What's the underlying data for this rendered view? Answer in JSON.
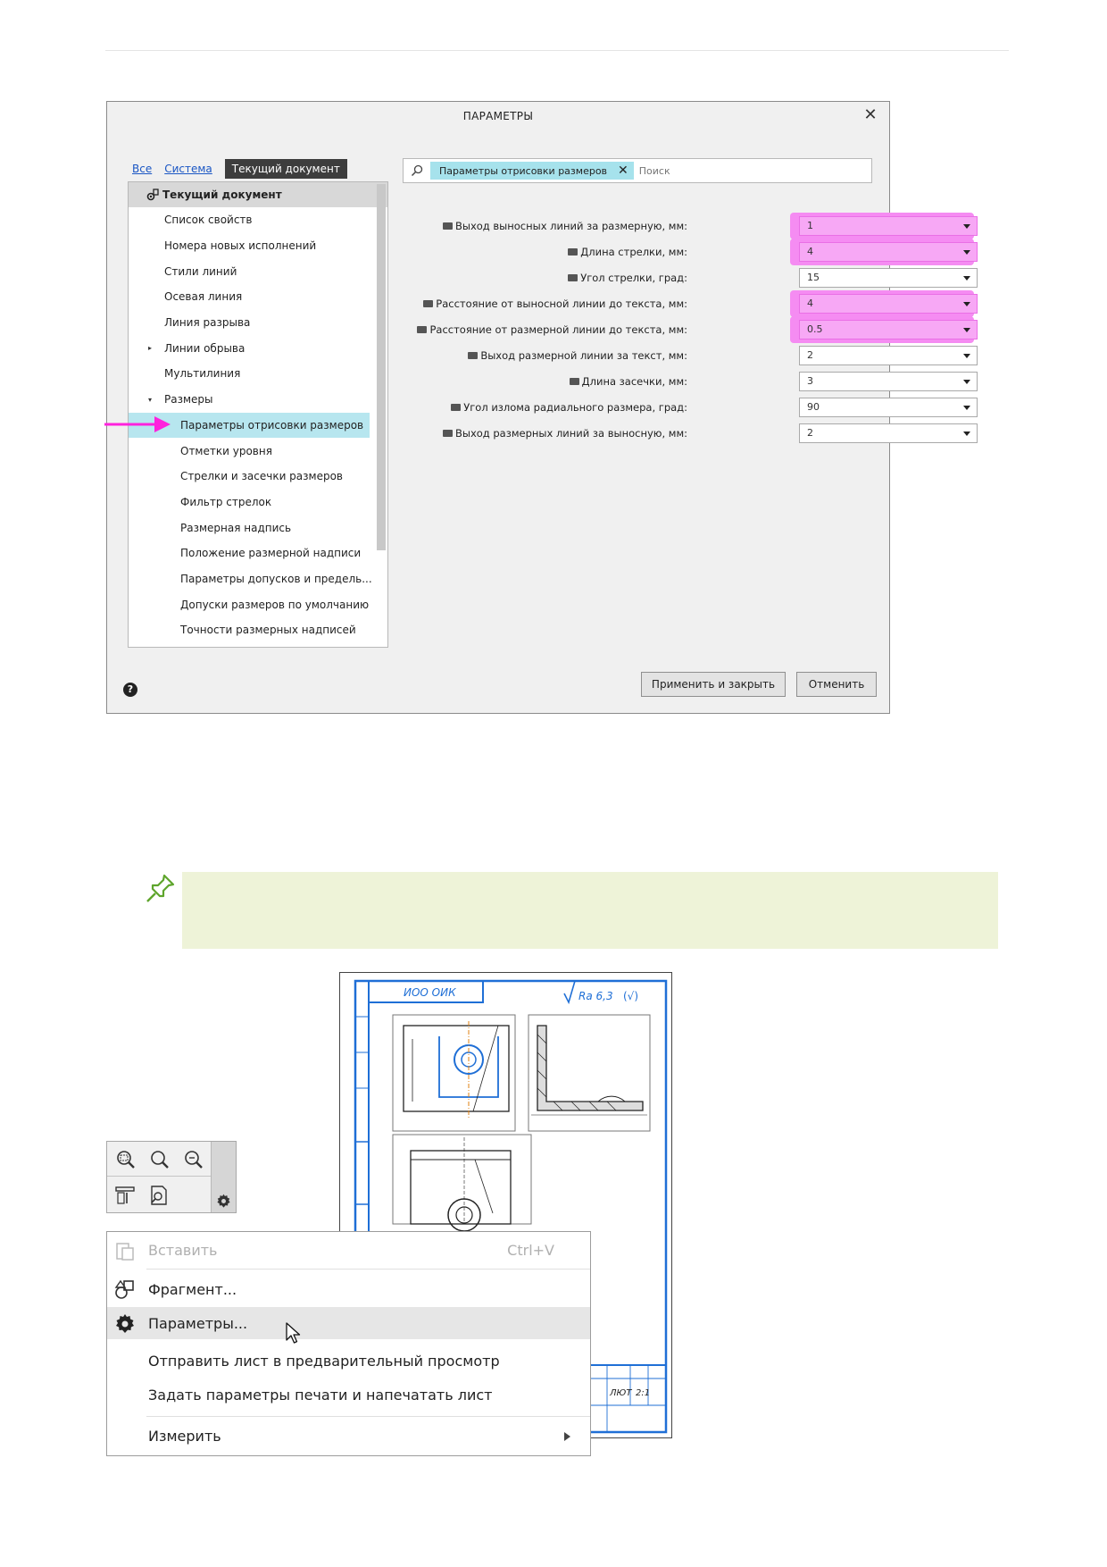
{
  "dialog": {
    "title": "ПАРАМЕТРЫ",
    "close_glyph": "✕",
    "scope_tabs": [
      {
        "label": "Все",
        "active": false
      },
      {
        "label": "Система",
        "active": false
      },
      {
        "label": "Текущий документ",
        "active": true
      }
    ],
    "tree": {
      "root": "Текущий документ",
      "items": [
        {
          "label": "Список свойств",
          "level": 1
        },
        {
          "label": "Номера новых исполнений",
          "level": 1
        },
        {
          "label": "Стили линий",
          "level": 1
        },
        {
          "label": "Осевая линия",
          "level": 1
        },
        {
          "label": "Линия разрыва",
          "level": 1
        },
        {
          "label": "Линии обрыва",
          "level": 1,
          "toggle": "▸"
        },
        {
          "label": "Мультилиния",
          "level": 1
        },
        {
          "label": "Размеры",
          "level": 1,
          "toggle": "▾"
        },
        {
          "label": "Параметры отрисовки размеров",
          "level": 2,
          "selected": true
        },
        {
          "label": "Отметки уровня",
          "level": 2
        },
        {
          "label": "Стрелки и засечки размеров",
          "level": 2
        },
        {
          "label": "Фильтр стрелок",
          "level": 2
        },
        {
          "label": "Размерная надпись",
          "level": 2
        },
        {
          "label": "Положение размерной надписи",
          "level": 2
        },
        {
          "label": "Параметры допусков и предель...",
          "level": 2
        },
        {
          "label": "Допуски размеров по умолчанию",
          "level": 2
        },
        {
          "label": "Точности размерных надписей",
          "level": 2
        }
      ]
    },
    "search": {
      "chip": "Параметры отрисовки размеров",
      "chip_close": "✕",
      "placeholder": "Поиск"
    },
    "params": [
      {
        "label": "Выход выносных линий за размерную, мм:",
        "value": "1",
        "highlighted": true
      },
      {
        "label": "Длина стрелки, мм:",
        "value": "4",
        "highlighted": true
      },
      {
        "label": "Угол стрелки, град:",
        "value": "15",
        "highlighted": false
      },
      {
        "label": "Расстояние от выносной линии до текста, мм:",
        "value": "4",
        "highlighted": true
      },
      {
        "label": "Расстояние от размерной линии до текста, мм:",
        "value": "0.5",
        "highlighted": true
      },
      {
        "label": "Выход размерной линии за текст, мм:",
        "value": "2",
        "highlighted": false
      },
      {
        "label": "Длина засечки, мм:",
        "value": "3",
        "highlighted": false
      },
      {
        "label": "Угол излома радиального размера, град:",
        "value": "90",
        "highlighted": false
      },
      {
        "label": "Выход размерных линий за выносную, мм:",
        "value": "2",
        "highlighted": false
      }
    ],
    "help_glyph": "?",
    "buttons": {
      "apply": "Применить и закрыть",
      "cancel": "Отменить"
    }
  },
  "context_menu": {
    "items": [
      {
        "label": "Вставить",
        "shortcut": "Ctrl+V",
        "disabled": true
      },
      {
        "label": "Фрагмент..."
      },
      {
        "label": "Параметры...",
        "hovered": true
      },
      {
        "label": "Отправить лист в предварительный просмотр"
      },
      {
        "label": "Задать параметры печати и напечатать лист"
      },
      {
        "label": "Измерить",
        "submenu": true
      }
    ]
  },
  "drawing": {
    "designation_stamp": "ИОО ОИК",
    "roughness": "Ra 6,3",
    "title_block": [
      "ЛЮТ",
      "2:1"
    ]
  },
  "colors": {
    "accent_highlight": "#f58cf2",
    "selection": "#b7e6ef",
    "chip": "#a6e2ec",
    "arrow": "#ff22dd",
    "drawing_frame": "#1f6fd6",
    "note_bg": "#eef3d8",
    "note_icon": "#5ea52c"
  }
}
